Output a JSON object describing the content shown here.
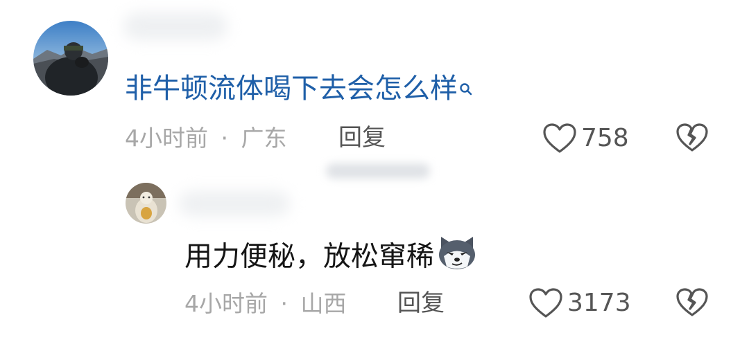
{
  "comments": [
    {
      "text": "非牛顿流体喝下去会怎么样",
      "search_icon": "search-icon",
      "time": "4小时前",
      "separator": "·",
      "location": "广东",
      "reply_label": "回复",
      "likes": "758",
      "text_color": "#1f5fa8"
    },
    {
      "text": "用力便秘，放松窜稀",
      "emoji": "husky-dog-emoji",
      "time": "4小时前",
      "separator": "·",
      "location": "山西",
      "reply_label": "回复",
      "likes": "3173",
      "text_color": "#151515"
    }
  ]
}
